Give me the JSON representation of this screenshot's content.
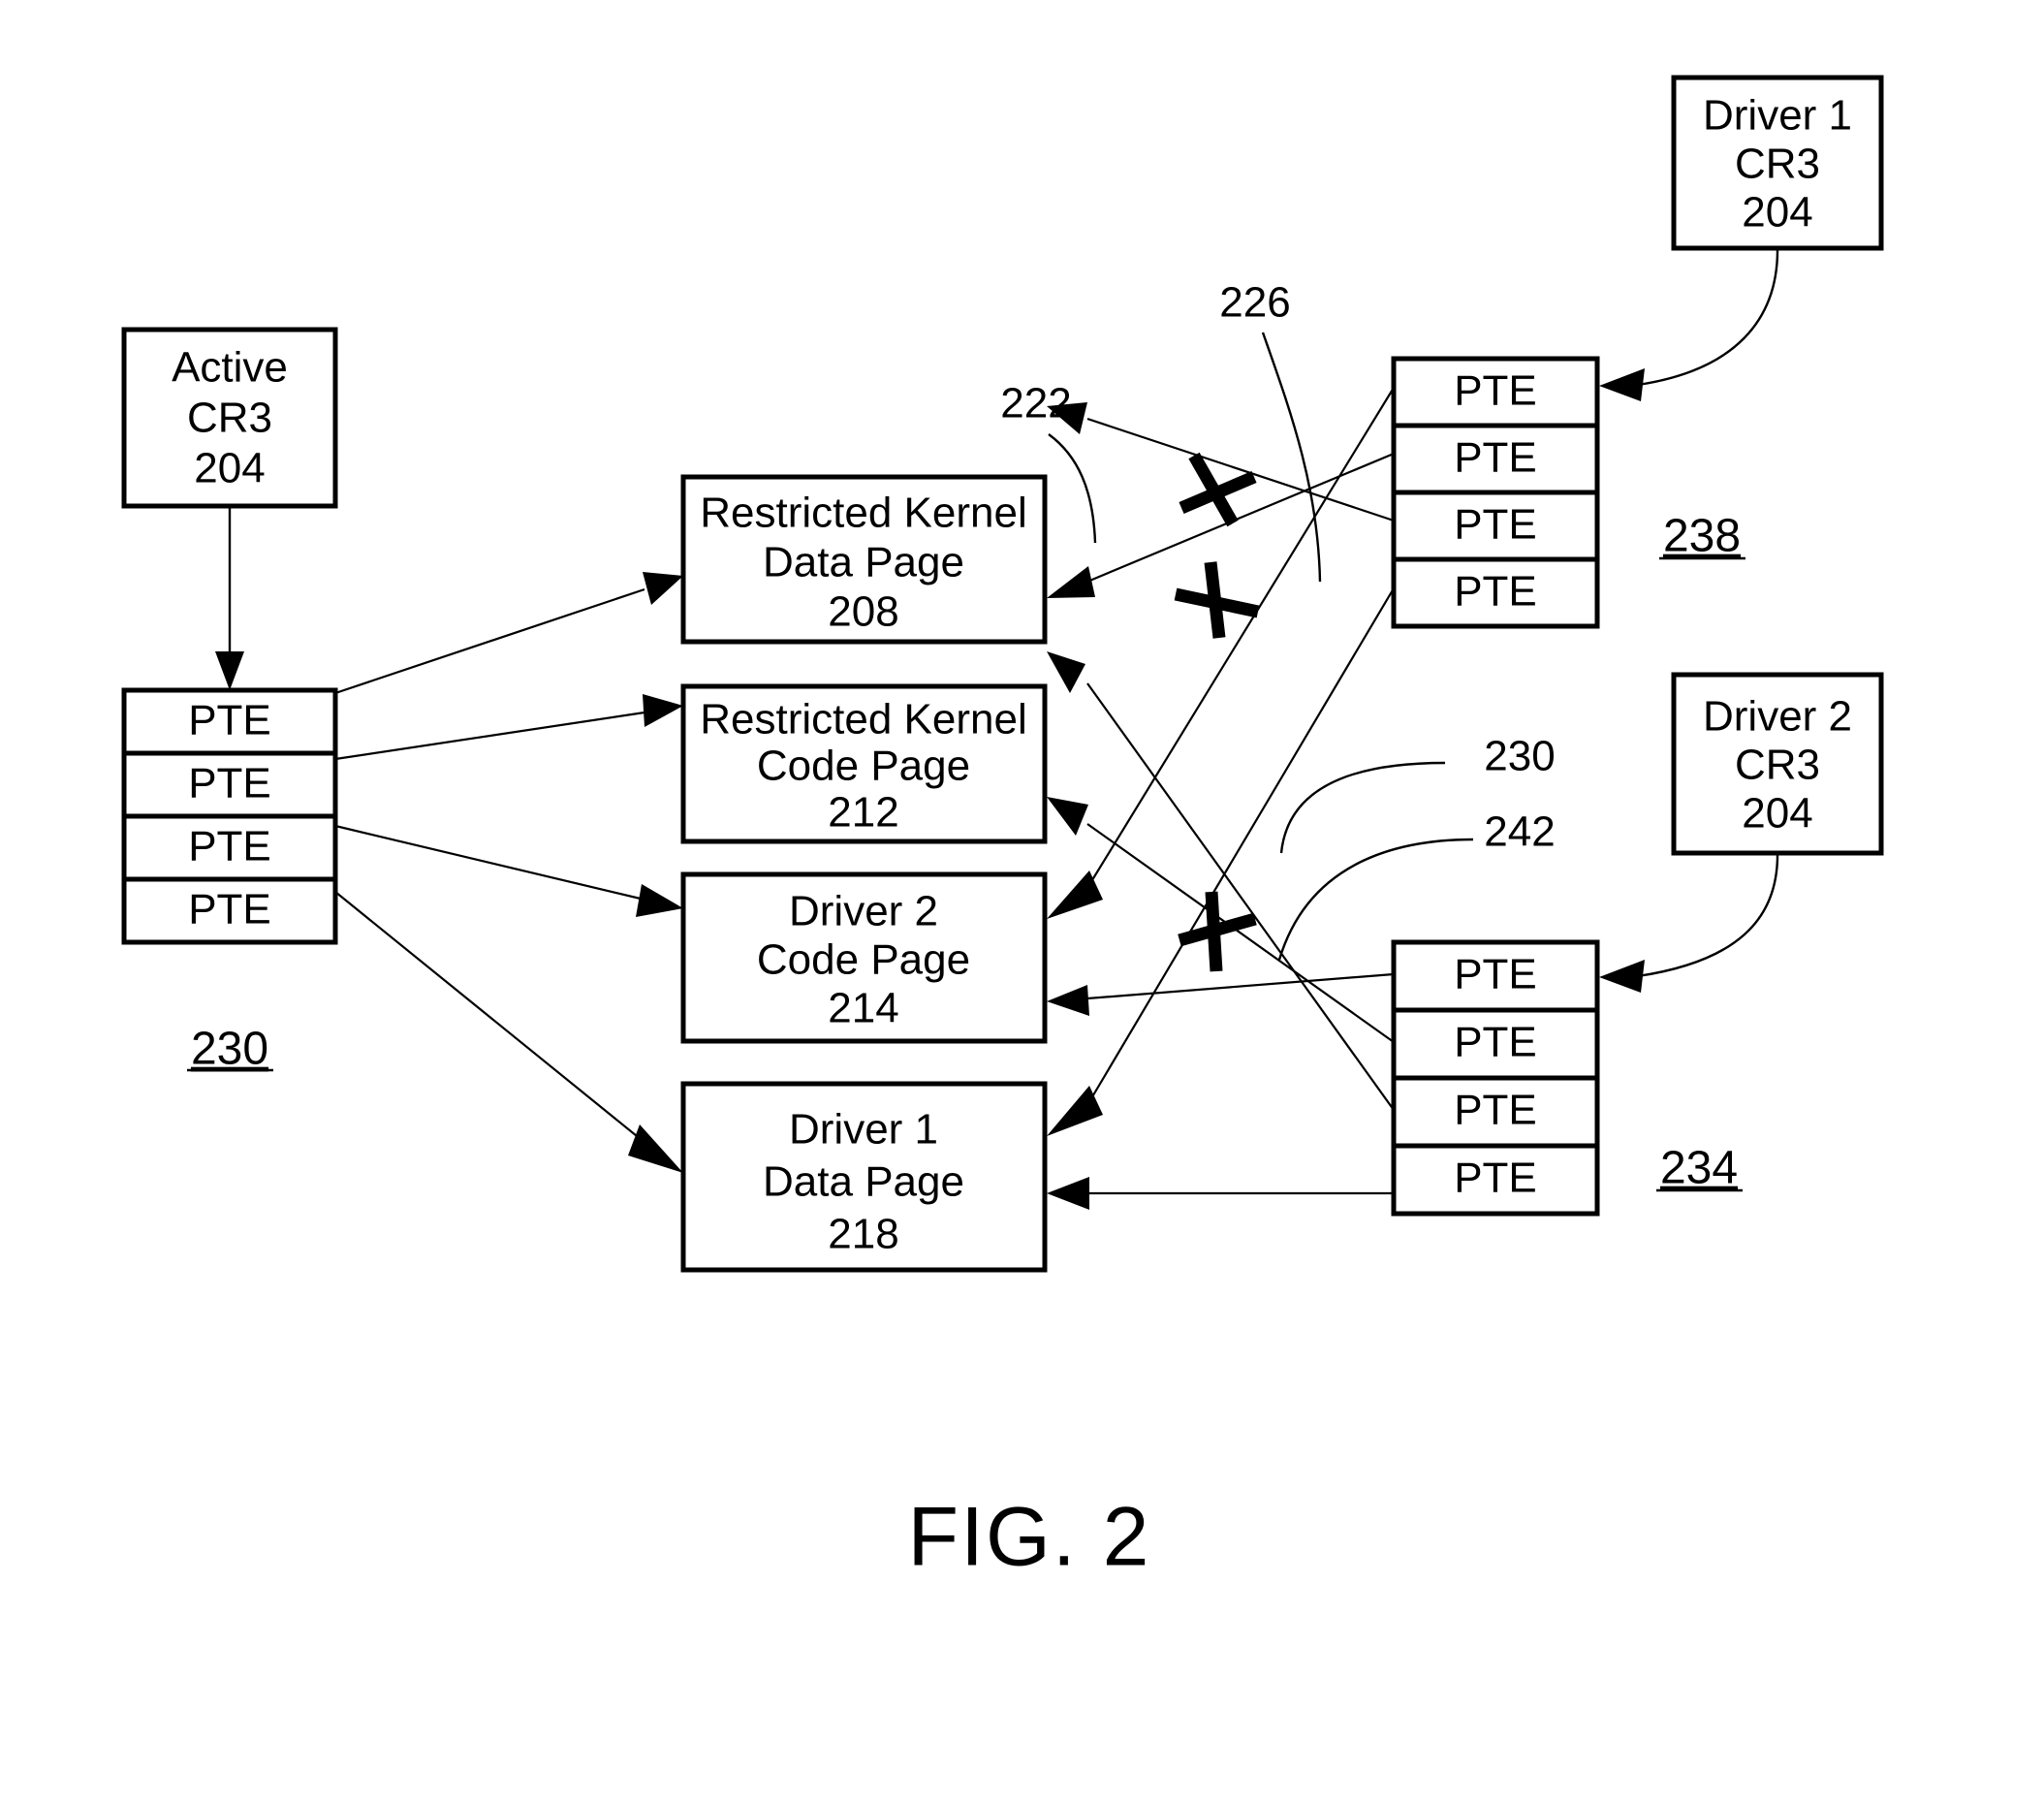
{
  "figure": {
    "caption": "FIG. 2",
    "pte_label": "PTE"
  },
  "left": {
    "cr3_box": {
      "line1": "Active",
      "line2": "CR3",
      "line3": "204"
    },
    "pte_table": {
      "ref": "230",
      "rows": [
        "PTE",
        "PTE",
        "PTE",
        "PTE"
      ]
    }
  },
  "center_pages": [
    {
      "line1": "Restricted Kernel",
      "line2": "Data Page",
      "line3": "208"
    },
    {
      "line1": "Restricted Kernel",
      "line2": "Code Page",
      "line3": "212"
    },
    {
      "line1": "Driver 2",
      "line2": "Code Page",
      "line3": "214"
    },
    {
      "line1": "Driver 1",
      "line2": "Data Page",
      "line3": "218"
    }
  ],
  "right": {
    "driver1_cr3_box": {
      "line1": "Driver 1",
      "line2": "CR3",
      "line3": "204"
    },
    "driver2_cr3_box": {
      "line1": "Driver 2",
      "line2": "CR3",
      "line3": "204"
    },
    "pte_table_238": {
      "ref": "238",
      "rows": [
        "PTE",
        "PTE",
        "PTE",
        "PTE"
      ]
    },
    "pte_table_234": {
      "ref": "234",
      "rows": [
        "PTE",
        "PTE",
        "PTE",
        "PTE"
      ]
    }
  },
  "reference_numbers": {
    "ref_222": "222",
    "ref_226": "226",
    "ref_230_mid": "230",
    "ref_242": "242"
  }
}
